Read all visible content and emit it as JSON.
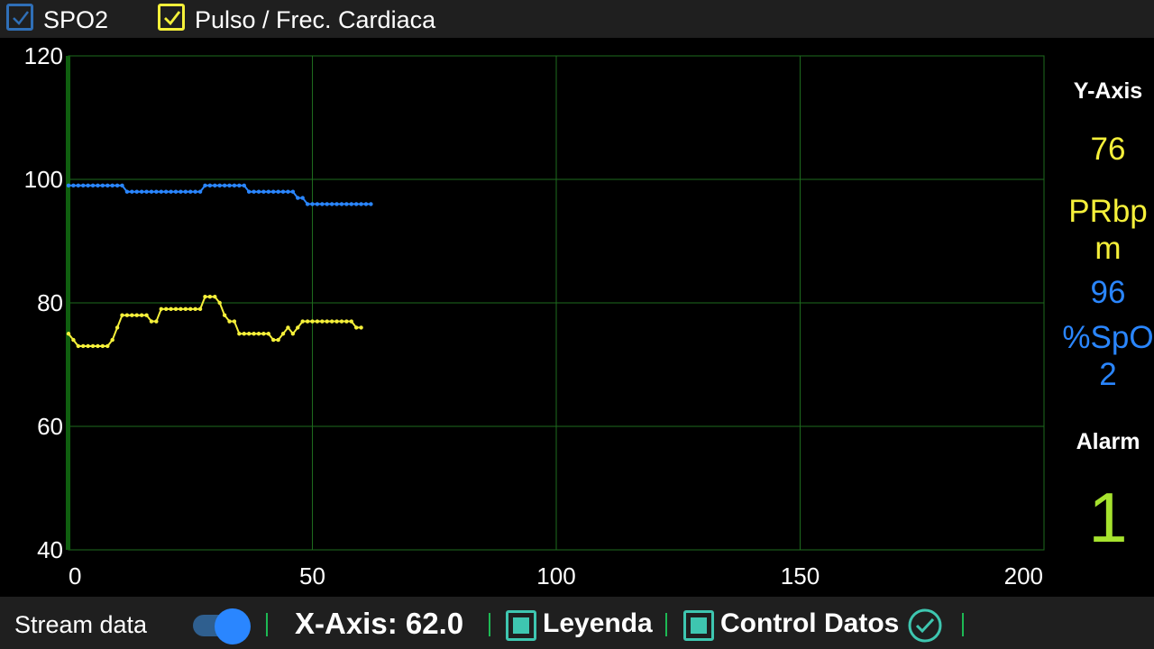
{
  "top_bar": {
    "spo2_checkbox": {
      "label": "SPO2",
      "checked": true,
      "color": "#2f6fb7"
    },
    "pulse_checkbox": {
      "label": "Pulso / Frec. Cardiaca",
      "checked": true,
      "color": "#f5f03a"
    }
  },
  "chart_data": {
    "type": "line",
    "x_range": [
      0,
      200
    ],
    "y_range": [
      40,
      120
    ],
    "x_ticks": [
      "0",
      "50",
      "100",
      "150",
      "200"
    ],
    "y_ticks": [
      "120",
      "100",
      "80",
      "60",
      "40"
    ],
    "grid": true,
    "series": [
      {
        "name": "SPO2",
        "color": "#2a86ff",
        "x": [
          0,
          1,
          2,
          3,
          4,
          5,
          6,
          7,
          8,
          9,
          10,
          11,
          12,
          13,
          14,
          15,
          16,
          17,
          18,
          19,
          20,
          21,
          22,
          23,
          24,
          25,
          26,
          27,
          28,
          29,
          30,
          31,
          32,
          33,
          34,
          35,
          36,
          37,
          38,
          39,
          40,
          41,
          42,
          43,
          44,
          45,
          46,
          47,
          48,
          49,
          50,
          51,
          52,
          53,
          54,
          55,
          56,
          57,
          58,
          59,
          60,
          61,
          62
        ],
        "y": [
          99,
          99,
          99,
          99,
          99,
          99,
          99,
          99,
          99,
          99,
          99,
          99,
          98,
          98,
          98,
          98,
          98,
          98,
          98,
          98,
          98,
          98,
          98,
          98,
          98,
          98,
          98,
          98,
          99,
          99,
          99,
          99,
          99,
          99,
          99,
          99,
          99,
          98,
          98,
          98,
          98,
          98,
          98,
          98,
          98,
          98,
          98,
          97,
          97,
          96,
          96,
          96,
          96,
          96,
          96,
          96,
          96,
          96,
          96,
          96,
          96,
          96,
          96
        ]
      },
      {
        "name": "Pulso / Frec. Cardiaca",
        "color": "#f5f03a",
        "x": [
          0,
          1,
          2,
          3,
          4,
          5,
          6,
          7,
          8,
          9,
          10,
          11,
          12,
          13,
          14,
          15,
          16,
          17,
          18,
          19,
          20,
          21,
          22,
          23,
          24,
          25,
          26,
          27,
          28,
          29,
          30,
          31,
          32,
          33,
          34,
          35,
          36,
          37,
          38,
          39,
          40,
          41,
          42,
          43,
          44,
          45,
          46,
          47,
          48,
          49,
          50,
          51,
          52,
          53,
          54,
          55,
          56,
          57,
          58,
          59,
          60
        ],
        "y": [
          75,
          74,
          73,
          73,
          73,
          73,
          73,
          73,
          73,
          74,
          76,
          78,
          78,
          78,
          78,
          78,
          78,
          77,
          77,
          79,
          79,
          79,
          79,
          79,
          79,
          79,
          79,
          79,
          81,
          81,
          81,
          80,
          78,
          77,
          77,
          75,
          75,
          75,
          75,
          75,
          75,
          75,
          74,
          74,
          75,
          76,
          75,
          76,
          77,
          77,
          77,
          77,
          77,
          77,
          77,
          77,
          77,
          77,
          77,
          76,
          76
        ]
      }
    ]
  },
  "right_panel": {
    "y_axis_label": "Y-Axis",
    "pr_value": "76",
    "pr_unit_line1": "PRbp",
    "pr_unit_line2": "m",
    "spo2_value": "96",
    "spo2_unit_line1": "%SpO",
    "spo2_unit_line2": "2",
    "alarm_label": "Alarm",
    "alarm_value": "1",
    "colors": {
      "pr": "#f5f03a",
      "spo2": "#2a86ff",
      "alarm": "#a6e22e"
    }
  },
  "bottom_bar": {
    "stream_label": "Stream data",
    "stream_toggle_on": true,
    "x_axis_text": "X-Axis: 62.0",
    "legend_label": "Leyenda",
    "control_label": "Control Datos",
    "accent_color": "#3ec6b0",
    "separator_color": "#1db954"
  }
}
